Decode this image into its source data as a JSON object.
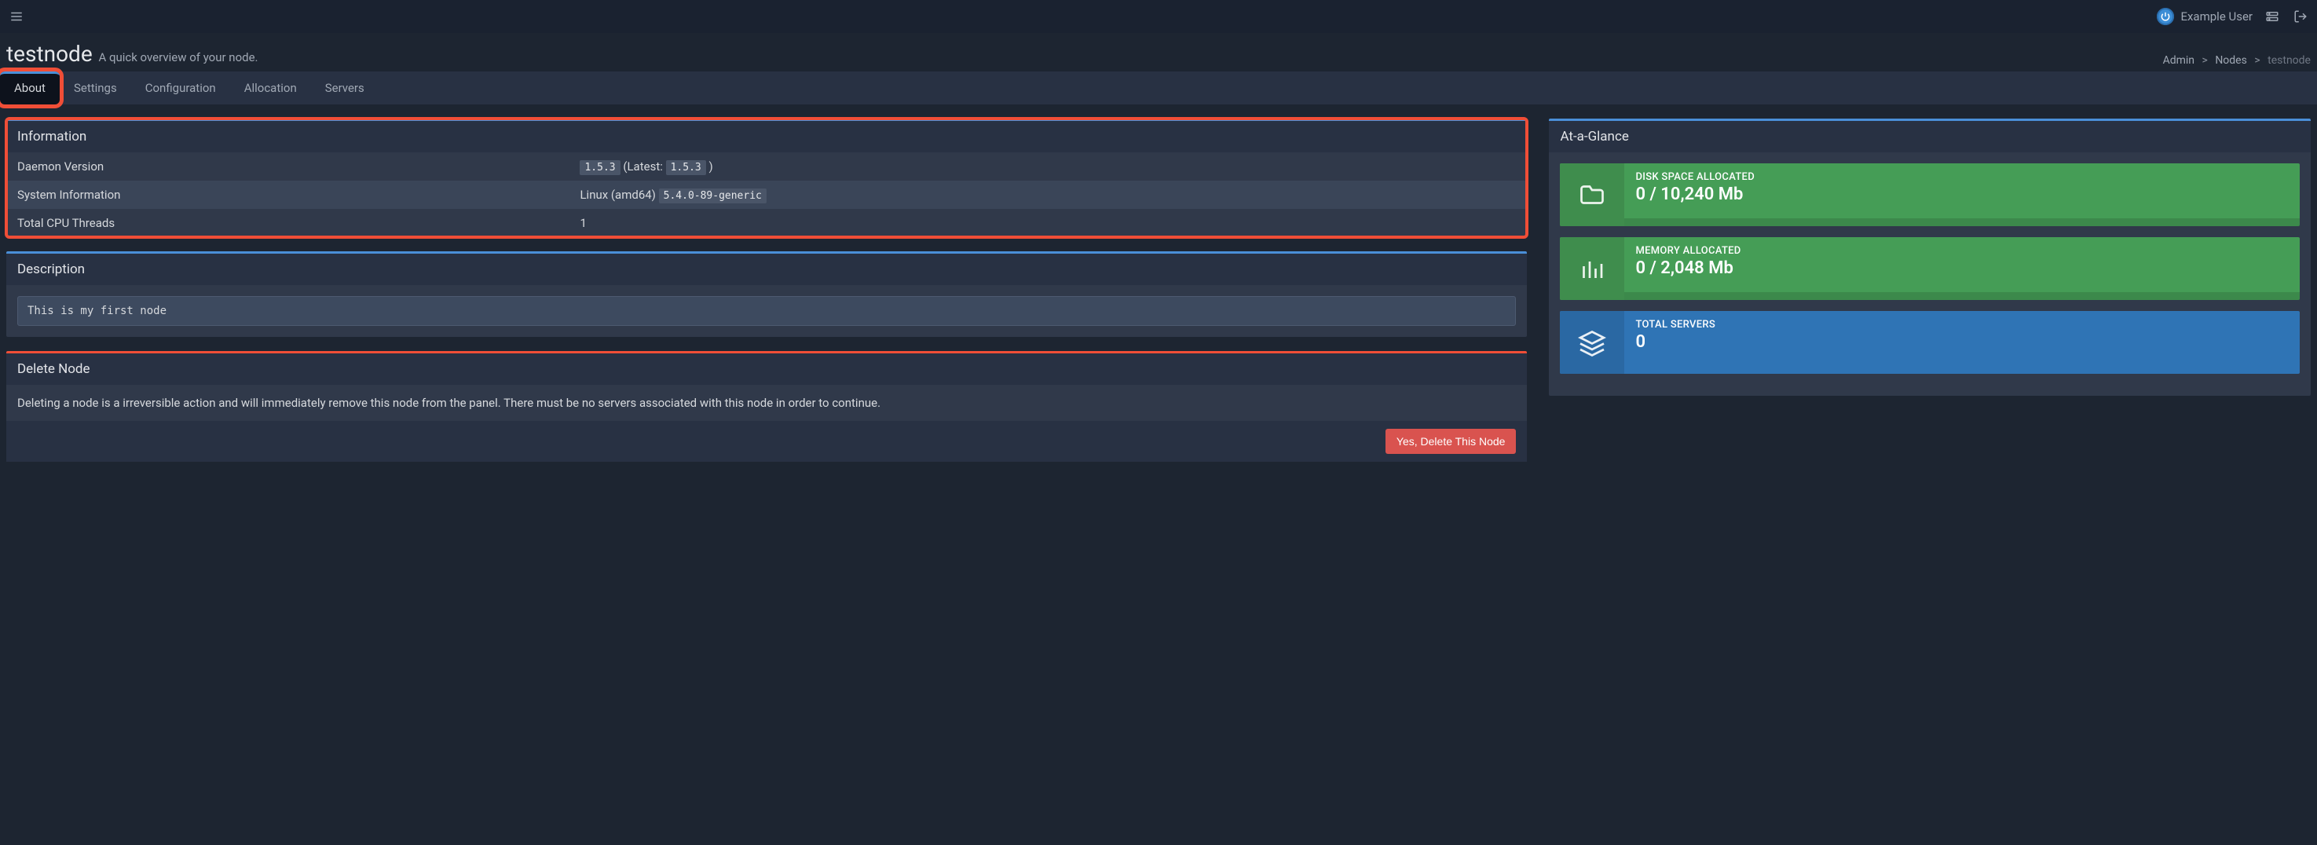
{
  "navbar": {
    "user_name": "Example User"
  },
  "header": {
    "title": "testnode",
    "subtitle": "A quick overview of your node."
  },
  "breadcrumbs": {
    "items": [
      "Admin",
      "Nodes",
      "testnode"
    ]
  },
  "tabs": {
    "items": [
      "About",
      "Settings",
      "Configuration",
      "Allocation",
      "Servers"
    ],
    "active_index": 0
  },
  "panels": {
    "information": {
      "title": "Information",
      "rows": {
        "daemon_version": {
          "label": "Daemon Version",
          "value_code": "1.5.3",
          "latest_prefix": "(Latest:",
          "latest_code": "1.5.3",
          "latest_suffix": ")"
        },
        "system_info": {
          "label": "System Information",
          "value_text": "Linux (amd64)",
          "value_code": "5.4.0-89-generic"
        },
        "cpu_threads": {
          "label": "Total CPU Threads",
          "value": "1"
        }
      }
    },
    "description": {
      "title": "Description",
      "text": "This is my first node"
    },
    "delete": {
      "title": "Delete Node",
      "body": "Deleting a node is a irreversible action and will immediately remove this node from the panel. There must be no servers associated with this node in order to continue.",
      "button": "Yes, Delete This Node"
    }
  },
  "glance": {
    "title": "At-a-Glance",
    "cards": {
      "disk": {
        "label": "DISK SPACE ALLOCATED",
        "value": "0 / 10,240 Mb"
      },
      "memory": {
        "label": "MEMORY ALLOCATED",
        "value": "0 / 2,048 Mb"
      },
      "servers": {
        "label": "TOTAL SERVERS",
        "value": "0"
      }
    }
  }
}
